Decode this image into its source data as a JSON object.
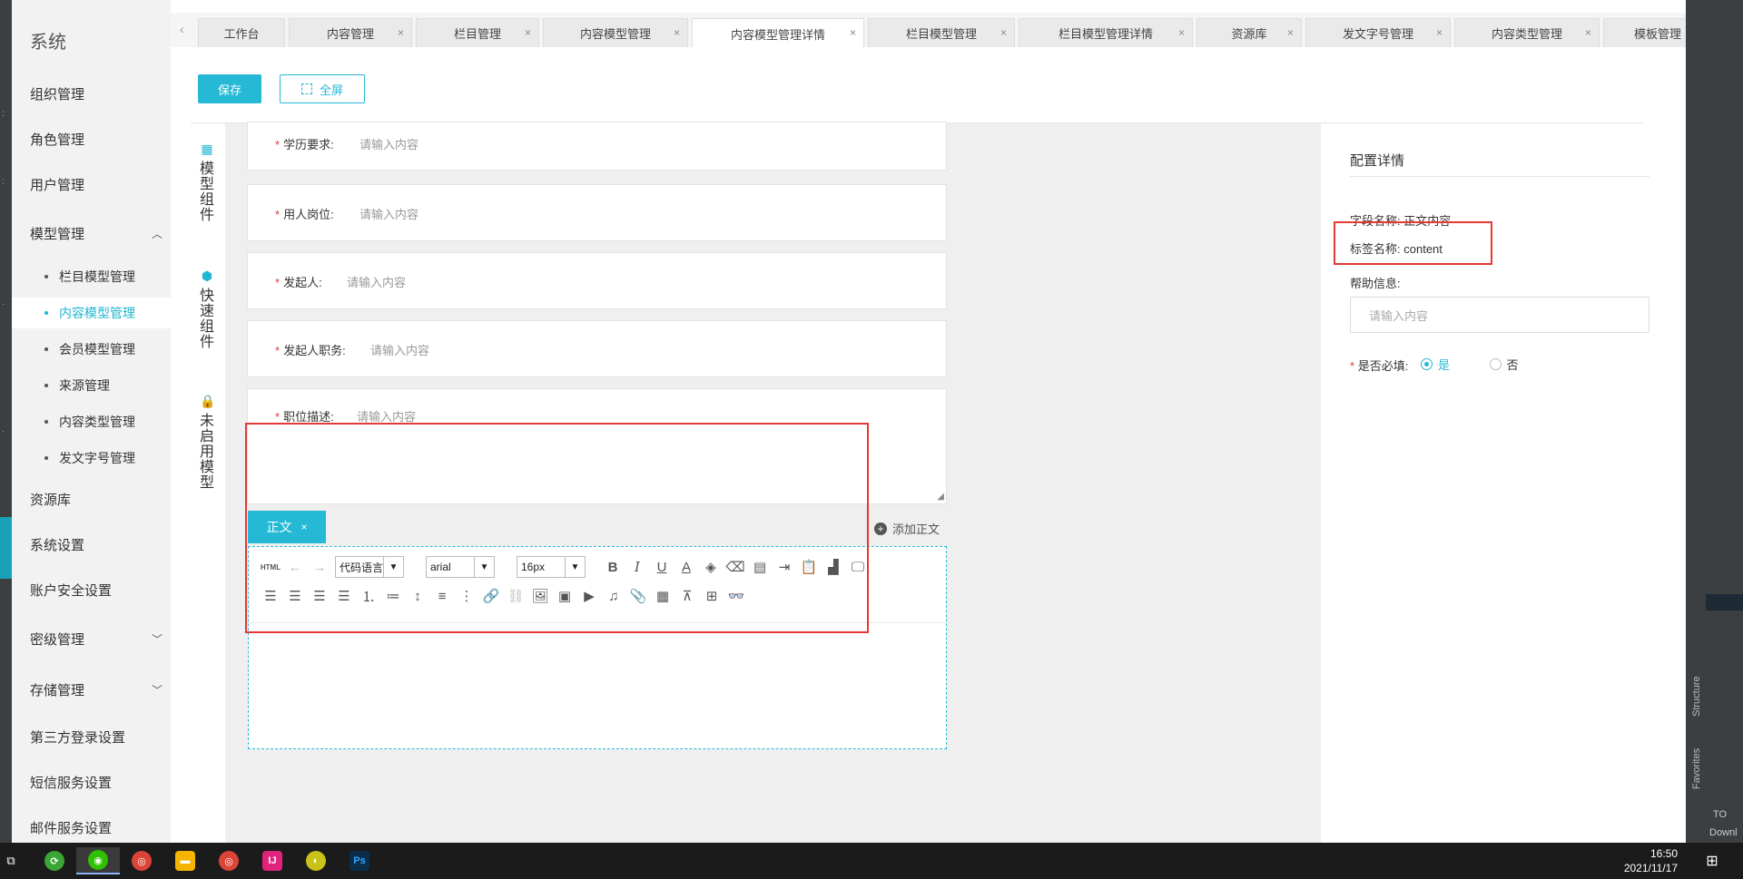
{
  "sidebar": {
    "system_title": "系统",
    "items": [
      {
        "label": "组织管理"
      },
      {
        "label": "角色管理"
      },
      {
        "label": "用户管理"
      },
      {
        "label": "模型管理"
      },
      {
        "label": "资源库"
      },
      {
        "label": "系统设置"
      },
      {
        "label": "账户安全设置"
      },
      {
        "label": "密级管理"
      },
      {
        "label": "存储管理"
      },
      {
        "label": "第三方登录设置"
      },
      {
        "label": "短信服务设置"
      },
      {
        "label": "邮件服务设置"
      }
    ],
    "sub_items": [
      {
        "label": "栏目模型管理"
      },
      {
        "label": "内容模型管理"
      },
      {
        "label": "会员模型管理"
      },
      {
        "label": "来源管理"
      },
      {
        "label": "内容类型管理"
      },
      {
        "label": "发文字号管理"
      }
    ]
  },
  "tabs": [
    {
      "label": "工作台"
    },
    {
      "label": "内容管理"
    },
    {
      "label": "栏目管理"
    },
    {
      "label": "内容模型管理"
    },
    {
      "label": "内容模型管理详情"
    },
    {
      "label": "栏目模型管理"
    },
    {
      "label": "栏目模型管理详情"
    },
    {
      "label": "资源库"
    },
    {
      "label": "发文字号管理"
    },
    {
      "label": "内容类型管理"
    },
    {
      "label": "模板管理"
    }
  ],
  "toolbar": {
    "save_label": "保存",
    "fullscreen_label": "全屏"
  },
  "component_panel": {
    "groups": [
      {
        "label": "模型组件"
      },
      {
        "label": "快速组件"
      },
      {
        "label": "未启用模型"
      }
    ]
  },
  "form": {
    "fields": [
      {
        "label": "学历要求:",
        "placeholder": "请输入内容"
      },
      {
        "label": "用人岗位:",
        "placeholder": "请输入内容"
      },
      {
        "label": "发起人:",
        "placeholder": "请输入内容"
      },
      {
        "label": "发起人职务:",
        "placeholder": "请输入内容"
      },
      {
        "label": "职位描述:",
        "placeholder": "请输入内容"
      }
    ],
    "required_mark": "*",
    "content_tab_label": "正文",
    "add_content_label": "添加正文",
    "editor": {
      "code_language": "代码语言",
      "font_family": "arial",
      "font_size": "16px",
      "html_label": "HTML"
    }
  },
  "config": {
    "title": "配置详情",
    "field_name_label": "字段名称:",
    "field_name_value": "正文内容",
    "tag_name_label": "标签名称:",
    "tag_name_value": "content",
    "help_label": "帮助信息:",
    "help_placeholder": "请输入内容",
    "required_label": "是否必填:",
    "yes": "是",
    "no": "否"
  },
  "ide_strip": {
    "structure": "Structure",
    "favorites": "Favorites",
    "todo": "TO",
    "download": "Downl"
  },
  "taskbar": {
    "time": "16:50",
    "date": "2021/11/17"
  },
  "colors": {
    "accent": "#25b9d6",
    "highlight_box": "#e53935"
  }
}
